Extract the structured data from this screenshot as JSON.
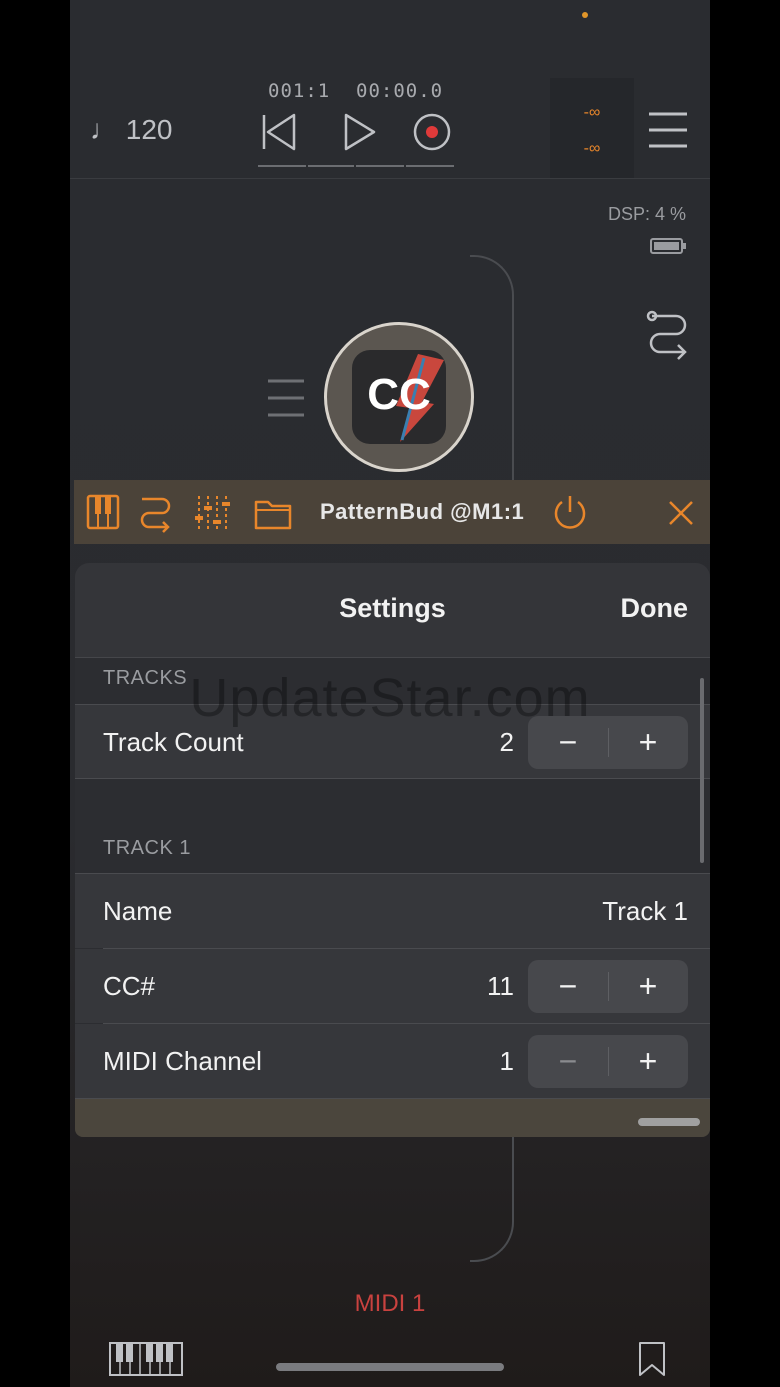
{
  "transport": {
    "tempo": "♩ 120",
    "bar_position": "001:1",
    "time": "00:00.0",
    "meter_left": "-∞",
    "meter_right": "-∞"
  },
  "status": {
    "dsp": "DSP:  4 %"
  },
  "node": {
    "label": "CC"
  },
  "plugin_bar": {
    "title": "PatternBud @M1:1"
  },
  "settings": {
    "title": "Settings",
    "done": "Done",
    "sections": {
      "tracks": "TRACKS",
      "track1": "TRACK 1"
    },
    "track_count": {
      "label": "Track Count",
      "value": "2"
    },
    "name": {
      "label": "Name",
      "value": "Track 1"
    },
    "cc": {
      "label": "CC#",
      "value": "11"
    },
    "midi_channel": {
      "label": "MIDI Channel",
      "value": "1"
    },
    "minus": "−",
    "plus": "+"
  },
  "footer": {
    "midi_label": "MIDI 1"
  },
  "watermark": "UpdateStar.com",
  "colors": {
    "accent": "#e8862b",
    "midi_red": "#c9423f",
    "record_red": "#e03a3a"
  }
}
